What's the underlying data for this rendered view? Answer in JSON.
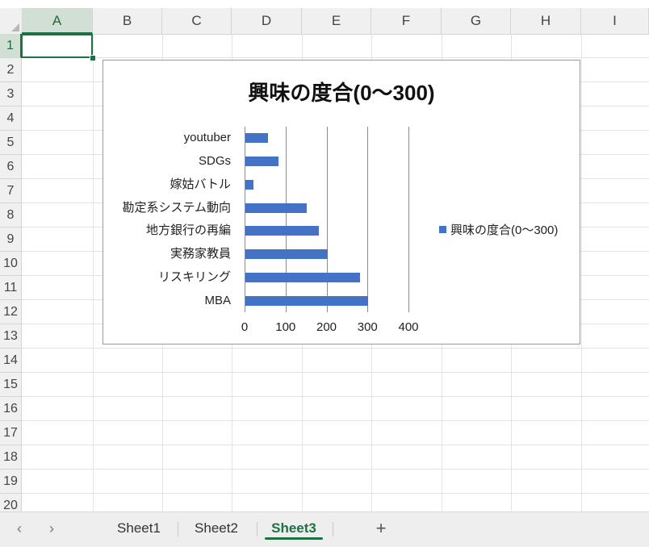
{
  "spreadsheet": {
    "columns": [
      "A",
      "B",
      "C",
      "D",
      "E",
      "F",
      "G",
      "H",
      "I"
    ],
    "rows": [
      "1",
      "2",
      "3",
      "4",
      "5",
      "6",
      "7",
      "8",
      "9",
      "10",
      "11",
      "12",
      "13",
      "14",
      "15",
      "16",
      "17",
      "18",
      "19",
      "20"
    ],
    "active_column": "A",
    "active_row": "1"
  },
  "chart_data": {
    "type": "bar",
    "orientation": "horizontal",
    "title": "興味の度合(0～300)",
    "categories": [
      "MBA",
      "リスキリング",
      "実務家教員",
      "地方銀行の再編",
      "勘定系システム動向",
      "嫁姑バトル",
      "SDGs",
      "youtuber"
    ],
    "series": [
      {
        "name": "興味の度合(0～300)",
        "values": [
          300,
          280,
          200,
          180,
          150,
          20,
          80,
          55
        ]
      }
    ],
    "xlim": [
      0,
      400
    ],
    "xticks": [
      "0",
      "100",
      "200",
      "300",
      "400"
    ],
    "grid": true,
    "legend": "right",
    "color": "#4472c4"
  },
  "sheets": {
    "nav_prev": "‹",
    "nav_next": "›",
    "tabs": [
      {
        "label": "Sheet1",
        "active": false
      },
      {
        "label": "Sheet2",
        "active": false
      },
      {
        "label": "Sheet3",
        "active": true
      }
    ],
    "add_label": "+"
  },
  "theme": {
    "accent": "#1e7145",
    "bar": "#4472c4"
  }
}
